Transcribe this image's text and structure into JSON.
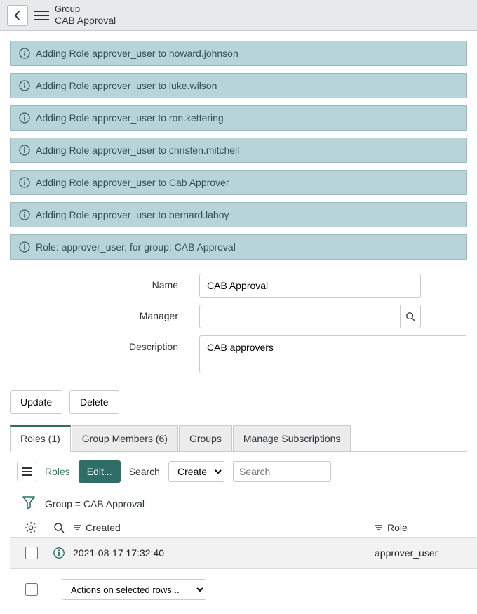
{
  "header": {
    "label": "Group",
    "value": "CAB Approval"
  },
  "notices": [
    "Adding Role approver_user to howard.johnson",
    "Adding Role approver_user to luke.wilson",
    "Adding Role approver_user to ron.kettering",
    "Adding Role approver_user to christen.mitchell",
    "Adding Role approver_user to Cab Approver",
    "Adding Role approver_user to bernard.laboy",
    "Role: approver_user, for group: CAB Approval"
  ],
  "form": {
    "name_label": "Name",
    "name_value": "CAB Approval",
    "manager_label": "Manager",
    "manager_value": "",
    "description_label": "Description",
    "description_value": "CAB approvers"
  },
  "buttons": {
    "update": "Update",
    "delete": "Delete",
    "edit": "Edit..."
  },
  "tabs": {
    "roles": "Roles (1)",
    "members": "Group Members (6)",
    "groups": "Groups",
    "subs": "Manage Subscriptions"
  },
  "toolbar": {
    "roles_label": "Roles",
    "search_label": "Search",
    "search_field_select": "Created",
    "search_placeholder": "Search"
  },
  "filter": {
    "text": "Group = CAB Approval"
  },
  "columns": {
    "created": "Created",
    "role": "Role"
  },
  "rows": [
    {
      "created": "2021-08-17 17:32:40",
      "role": "approver_user"
    }
  ],
  "actions_select_placeholder": "Actions on selected rows..."
}
